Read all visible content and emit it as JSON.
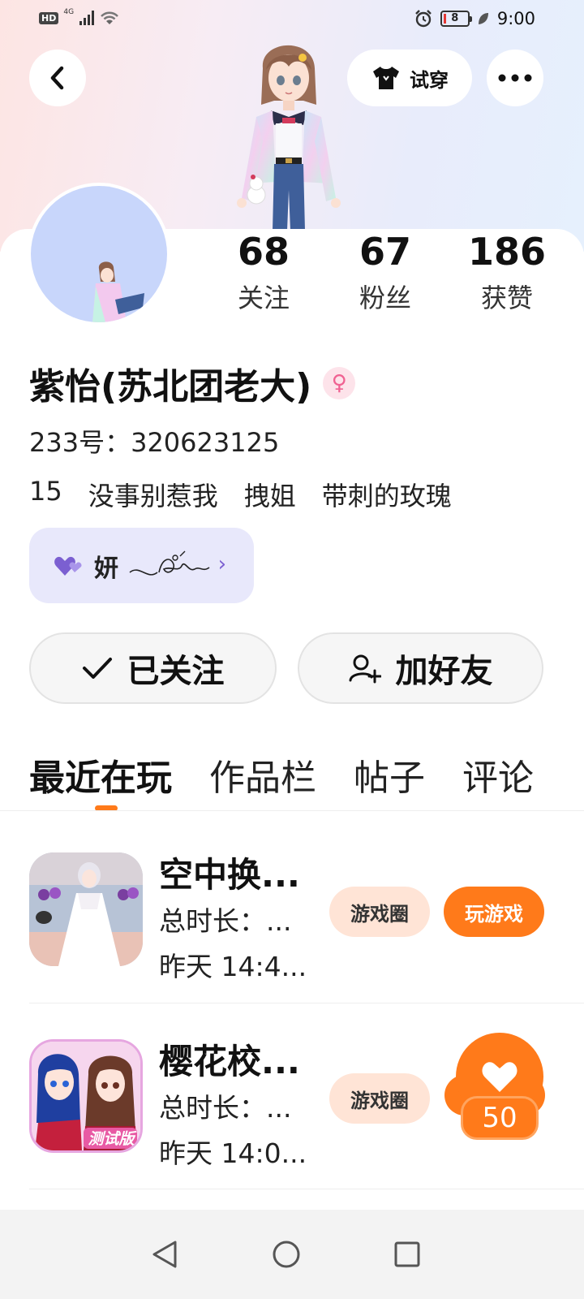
{
  "status_bar": {
    "hd": "HD",
    "network": "4G",
    "battery": "8",
    "time": "9:00"
  },
  "header": {
    "try_on_label": "试穿"
  },
  "profile": {
    "stats": [
      {
        "value": "68",
        "label": "关注"
      },
      {
        "value": "67",
        "label": "粉丝"
      },
      {
        "value": "186",
        "label": "获赞"
      }
    ],
    "name": "紫怡(苏北团老大)",
    "uid": "233号：320623125",
    "tags": [
      "15",
      "没事别惹我",
      "拽姐",
      "带刺的玫瑰"
    ],
    "badge": "妍",
    "buttons": {
      "following": "已关注",
      "add_friend": "加好友"
    }
  },
  "tabs": [
    "最近在玩",
    "作品栏",
    "帖子",
    "评论"
  ],
  "games": [
    {
      "title": "空中换...",
      "duration": "总时长：...",
      "last_played": "昨天 14:4...",
      "circle_label": "游戏圈",
      "play_label": "玩游戏"
    },
    {
      "title": "樱花校...",
      "duration": "总时长：...",
      "last_played": "昨天 14:0...",
      "circle_label": "游戏圈"
    }
  ],
  "icon_badge_text": "测试版",
  "like_float": {
    "count": "50"
  },
  "colors": {
    "accent": "#ff7a1a",
    "chip_bg": "#ffe4d6",
    "badge_bg": "#e8e8fb"
  }
}
